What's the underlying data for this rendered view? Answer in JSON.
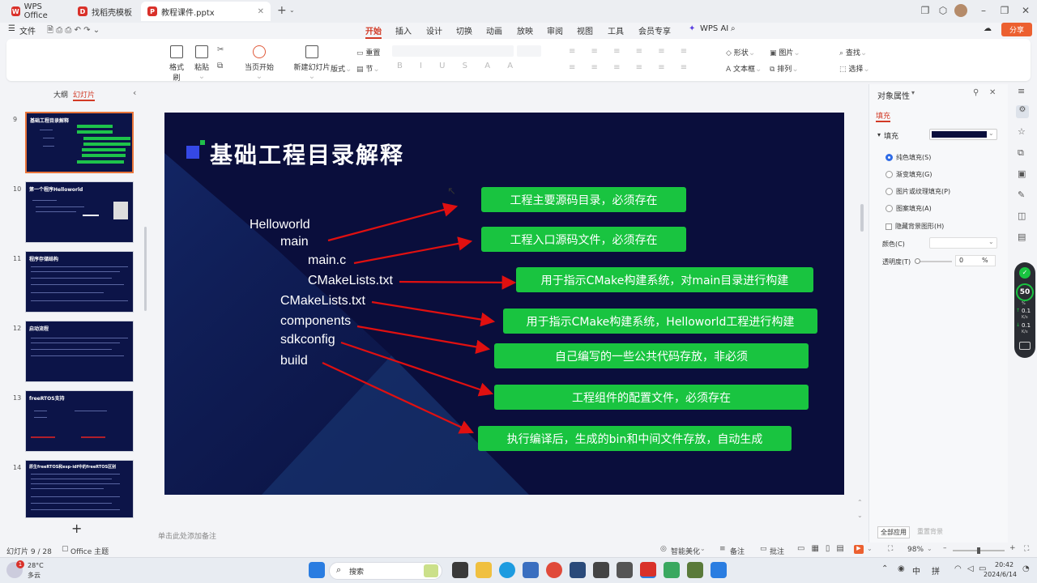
{
  "tabs": [
    {
      "label": "WPS Office",
      "logo_color": "#d9312a"
    },
    {
      "label": "找稻壳模板",
      "logo_color": "#d9312a"
    },
    {
      "label": "教程课件.pptx",
      "logo_color": "#d9312a"
    }
  ],
  "menu": {
    "file": "文件",
    "items": [
      "开始",
      "插入",
      "设计",
      "切换",
      "动画",
      "放映",
      "审阅",
      "视图",
      "工具",
      "会员专享"
    ],
    "ai": "WPS AI",
    "share": "分享"
  },
  "ribbon": {
    "format_painter": "格式刷",
    "paste": "粘贴",
    "from_current": "当页开始",
    "new_slide": "新建幻灯片",
    "layout": "版式",
    "section": "节",
    "reset": "重置",
    "shape": "形状",
    "picture": "图片",
    "textbox": "文本框",
    "arrange": "排列",
    "find": "查找",
    "select": "选择"
  },
  "left_panel": {
    "tab_outline": "大纲",
    "tab_slides": "幻灯片",
    "thumbs": [
      {
        "num": "9",
        "title": "基础工程目录解释"
      },
      {
        "num": "10",
        "title": "第一个程序Helloworld"
      },
      {
        "num": "11",
        "title": "程序存储结构"
      },
      {
        "num": "12",
        "title": "启动流程"
      },
      {
        "num": "13",
        "title": "freeRTOS支持"
      },
      {
        "num": "14",
        "title": "原生freeRTOS和esp-idf中的freeRTOS区别"
      }
    ],
    "add": "+"
  },
  "slide": {
    "title": "基础工程目录解释",
    "tree": [
      "Helloworld",
      "main",
      "main.c",
      "CMakeLists.txt",
      "CMakeLists.txt",
      "components",
      "sdkconfig",
      "build"
    ],
    "boxes": [
      "工程主要源码目录，必须存在",
      "工程入口源码文件，必须存在",
      "用于指示CMake构建系统，对main目录进行构建",
      "用于指示CMake构建系统，Helloworld工程进行构建",
      "自己编写的一些公共代码存放，非必须",
      "工程组件的配置文件，必须存在",
      "执行编译后，生成的bin和中间文件存放，自动生成"
    ]
  },
  "notes_placeholder": "单击此处添加备注",
  "right_pane": {
    "title": "对象属性",
    "tab_fill": "填充",
    "fill_label": "填充",
    "fill_color": "#0a0e3c",
    "options": [
      "纯色填充(S)",
      "渐变填充(G)",
      "图片或纹理填充(P)",
      "图案填充(A)"
    ],
    "hide_bg": "隐藏背景图形(H)",
    "color_label": "颜色(C)",
    "transparency_label": "透明度(T)",
    "transparency_value": "0",
    "transparency_unit": "%",
    "apply_all": "全部应用",
    "reset_bg": "重置背景"
  },
  "speed_widget": {
    "value": "50",
    "unit": "%",
    "up": "0.1",
    "down": "0.1",
    "rate": "K/s"
  },
  "status": {
    "slide_info": "幻灯片 9 / 28",
    "theme": "Office 主题",
    "smart": "智能美化",
    "notes": "备注",
    "comments": "批注",
    "zoom": "98%"
  },
  "taskbar": {
    "temp": "28°C",
    "weather": "多云",
    "search": "搜索",
    "time": "20:42",
    "date": "2024/6/14",
    "ime1": "中",
    "ime2": "拼",
    "notif": "1"
  }
}
